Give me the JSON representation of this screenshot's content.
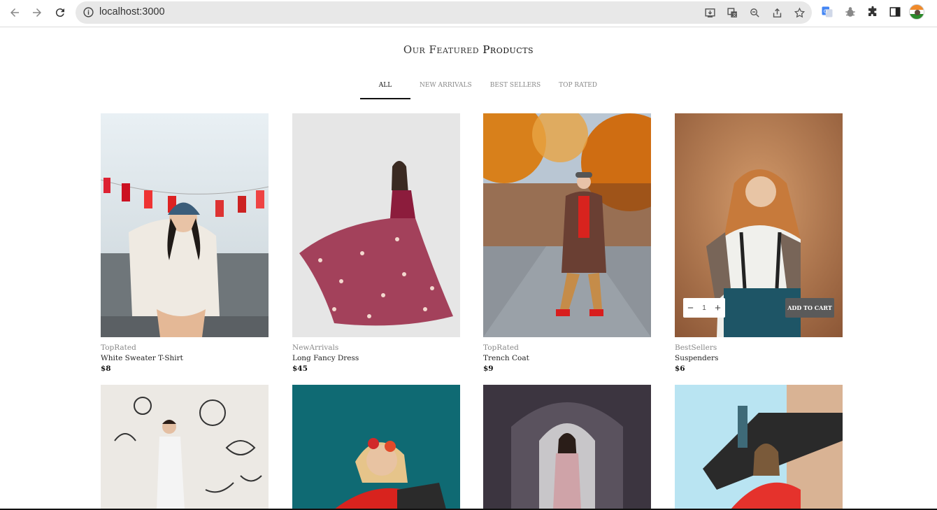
{
  "browser": {
    "url": "localhost:3000",
    "icons": [
      "back-icon",
      "forward-icon",
      "reload-icon",
      "info-icon",
      "install-icon",
      "translate-icon",
      "zoom-icon",
      "share-icon",
      "bookmark-star-icon",
      "google-translate-extension-icon",
      "bug-extension-icon",
      "extensions-puzzle-icon",
      "side-panel-icon",
      "profile-avatar"
    ]
  },
  "section": {
    "title_light": "Our Featured ",
    "title_bold": "Products"
  },
  "tabs": [
    {
      "label": "All",
      "active": true
    },
    {
      "label": "New Arrivals",
      "active": false
    },
    {
      "label": "Best Sellers",
      "active": false
    },
    {
      "label": "Top Rated",
      "active": false
    }
  ],
  "products": [
    {
      "category": "TopRated",
      "name": "White Sweater T-Shirt",
      "price": "$8"
    },
    {
      "category": "NewArrivals",
      "name": "Long Fancy Dress",
      "price": "$45"
    },
    {
      "category": "TopRated",
      "name": "Trench Coat",
      "price": "$9"
    },
    {
      "category": "BestSellers",
      "name": "Suspenders",
      "price": "$6"
    }
  ],
  "hover_card": {
    "quantity": "1",
    "minus": "−",
    "plus": "+",
    "add_to_cart": "ADD TO CART"
  },
  "colors": {
    "accent": "#111111",
    "muted": "#888888",
    "cart_button": "#5a5a5a"
  }
}
